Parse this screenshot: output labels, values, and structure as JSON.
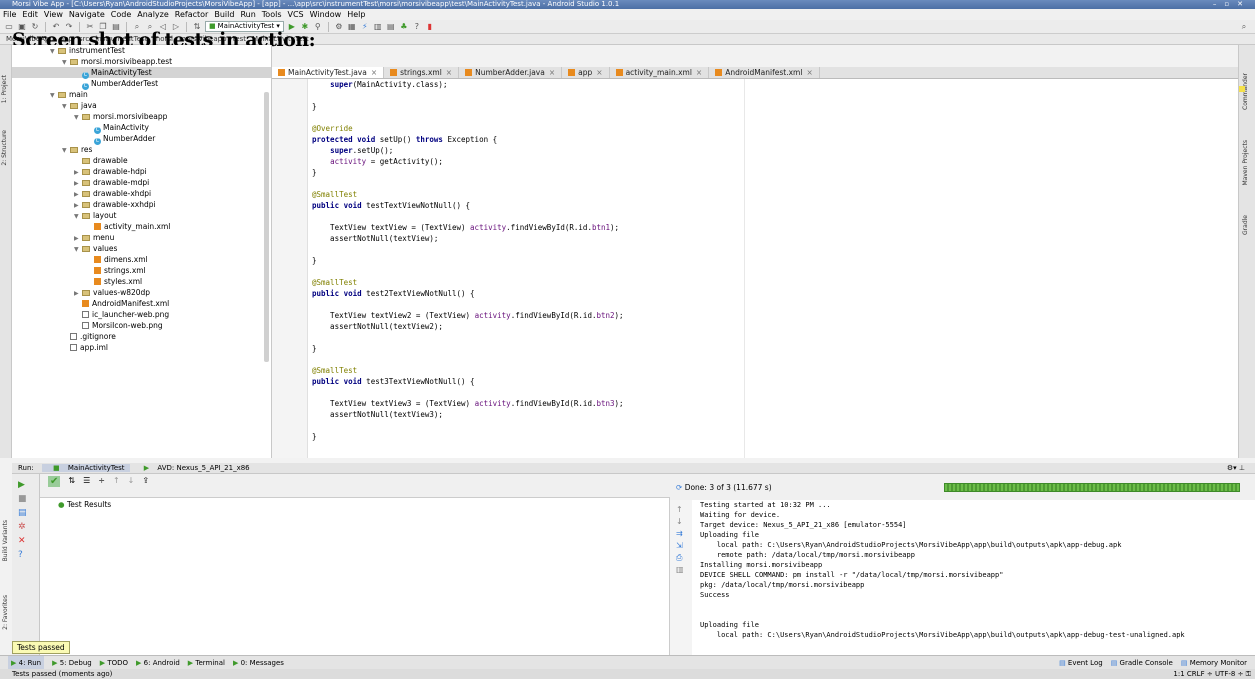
{
  "window": {
    "title": "Morsi Vibe App - [C:\\Users\\Ryan\\AndroidStudioProjects\\MorsiVibeApp] - [app] - ...\\app\\src\\instrumentTest\\morsi\\morsivibeapp\\test\\MainActivityTest.java - Android Studio 1.0.1"
  },
  "overlay_title": "Screen shot of tests in action:",
  "menu": [
    "File",
    "Edit",
    "View",
    "Navigate",
    "Code",
    "Analyze",
    "Refactor",
    "Build",
    "Run",
    "Tools",
    "VCS",
    "Window",
    "Help"
  ],
  "toolbar": {
    "run_config": "MainActivityTest"
  },
  "navbar": [
    "MorsiVibeApp",
    "app",
    "src",
    "instrumentTest",
    "morsi",
    "morsivibeapp",
    "test",
    "MainActivityTest"
  ],
  "project_tree": [
    {
      "label": "instrumentTest",
      "indent": 0,
      "kind": "folder",
      "open": true
    },
    {
      "label": "morsi.morsivibeapp.test",
      "indent": 1,
      "kind": "folder",
      "open": true
    },
    {
      "label": "MainActivityTest",
      "indent": 2,
      "kind": "class",
      "selected": true
    },
    {
      "label": "NumberAdderTest",
      "indent": 2,
      "kind": "class"
    },
    {
      "label": "main",
      "indent": 0,
      "kind": "folder",
      "open": true
    },
    {
      "label": "java",
      "indent": 1,
      "kind": "folder",
      "open": true
    },
    {
      "label": "morsi.morsivibeapp",
      "indent": 2,
      "kind": "folder",
      "open": true
    },
    {
      "label": "MainActivity",
      "indent": 3,
      "kind": "class"
    },
    {
      "label": "NumberAdder",
      "indent": 3,
      "kind": "class"
    },
    {
      "label": "res",
      "indent": 1,
      "kind": "folder",
      "open": true
    },
    {
      "label": "drawable",
      "indent": 2,
      "kind": "folder"
    },
    {
      "label": "drawable-hdpi",
      "indent": 2,
      "kind": "folder",
      "closed": true
    },
    {
      "label": "drawable-mdpi",
      "indent": 2,
      "kind": "folder",
      "closed": true
    },
    {
      "label": "drawable-xhdpi",
      "indent": 2,
      "kind": "folder",
      "closed": true
    },
    {
      "label": "drawable-xxhdpi",
      "indent": 2,
      "kind": "folder",
      "closed": true
    },
    {
      "label": "layout",
      "indent": 2,
      "kind": "folder",
      "open": true
    },
    {
      "label": "activity_main.xml",
      "indent": 3,
      "kind": "xml"
    },
    {
      "label": "menu",
      "indent": 2,
      "kind": "folder",
      "closed": true
    },
    {
      "label": "values",
      "indent": 2,
      "kind": "folder",
      "open": true
    },
    {
      "label": "dimens.xml",
      "indent": 3,
      "kind": "xml"
    },
    {
      "label": "strings.xml",
      "indent": 3,
      "kind": "xml"
    },
    {
      "label": "styles.xml",
      "indent": 3,
      "kind": "xml"
    },
    {
      "label": "values-w820dp",
      "indent": 2,
      "kind": "folder",
      "closed": true
    },
    {
      "label": "AndroidManifest.xml",
      "indent": 2,
      "kind": "xml"
    },
    {
      "label": "ic_launcher-web.png",
      "indent": 2,
      "kind": "file"
    },
    {
      "label": "MorsiIcon-web.png",
      "indent": 2,
      "kind": "file"
    },
    {
      "label": ".gitignore",
      "indent": 1,
      "kind": "file"
    },
    {
      "label": "app.iml",
      "indent": 1,
      "kind": "file"
    }
  ],
  "editor_tabs": [
    {
      "label": "MainActivityTest.java",
      "active": true
    },
    {
      "label": "strings.xml"
    },
    {
      "label": "NumberAdder.java"
    },
    {
      "label": "app"
    },
    {
      "label": "activity_main.xml"
    },
    {
      "label": "AndroidManifest.xml"
    }
  ],
  "code_lines": [
    "    super(MainActivity.class);",
    "",
    "}",
    "",
    "@Override",
    "protected void setUp() throws Exception {",
    "    super.setUp();",
    "    activity = getActivity();",
    "}",
    "",
    "@SmallTest",
    "public void testTextViewNotNull() {",
    "",
    "    TextView textView = (TextView) activity.findViewById(R.id.btn1);",
    "    assertNotNull(textView);",
    "",
    "}",
    "",
    "@SmallTest",
    "public void test2TextViewNotNull() {",
    "",
    "    TextView textView2 = (TextView) activity.findViewById(R.id.btn2);",
    "    assertNotNull(textView2);",
    "",
    "}",
    "",
    "@SmallTest",
    "public void test3TextViewNotNull() {",
    "",
    "    TextView textView3 = (TextView) activity.findViewById(R.id.btn3);",
    "    assertNotNull(textView3);",
    "",
    "}"
  ],
  "run_panel": {
    "label": "Run:",
    "tab_test": "MainActivityTest",
    "tab_avd": "AVD: Nexus_5_API_21_x86",
    "results_label": "Test Results",
    "done": "Done: 3 of 3  (11.677 s)",
    "tooltip": "Tests passed",
    "progress": 1.0
  },
  "console_lines": [
    "Testing started at 10:32 PM ...",
    "Waiting for device.",
    "Target device: Nexus_5_API_21_x86 [emulator-5554]",
    "Uploading file",
    "    local path: C:\\Users\\Ryan\\AndroidStudioProjects\\MorsiVibeApp\\app\\build\\outputs\\apk\\app-debug.apk",
    "    remote path: /data/local/tmp/morsi.morsivibeapp",
    "Installing morsi.morsivibeapp",
    "DEVICE SHELL COMMAND: pm install -r \"/data/local/tmp/morsi.morsivibeapp\"",
    "pkg: /data/local/tmp/morsi.morsivibeapp",
    "Success",
    "",
    "",
    "Uploading file",
    "    local path: C:\\Users\\Ryan\\AndroidStudioProjects\\MorsiVibeApp\\app\\build\\outputs\\apk\\app-debug-test-unaligned.apk"
  ],
  "bottom_tools": [
    "4: Run",
    "5: Debug",
    "TODO",
    "6: Android",
    "Terminal",
    "0: Messages"
  ],
  "bottom_right": [
    "Event Log",
    "Gradle Console",
    "Memory Monitor"
  ],
  "status": {
    "message": "Tests passed (moments ago)",
    "position": "1:1",
    "line_sep": "CRLF",
    "encoding": "UTF-8"
  },
  "side_labels": {
    "project": "1: Project",
    "structure": "2: Structure",
    "build_variants": "Build Variants",
    "favorites": "2: Favorites",
    "commander": "Commander",
    "maven": "Maven Projects",
    "gradle": "Gradle"
  }
}
